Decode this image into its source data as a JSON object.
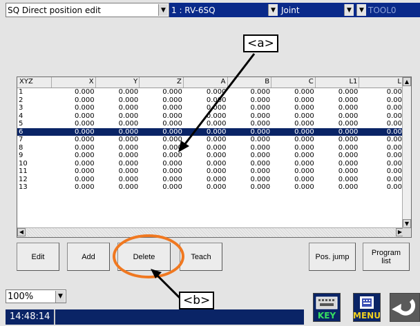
{
  "toolbar": {
    "program": "SQ Direct position edit",
    "robot": "1 : RV-6SQ",
    "mode": "Joint",
    "tool": "TOOL0"
  },
  "grid": {
    "headers": [
      "XYZ",
      "X",
      "Y",
      "Z",
      "A",
      "B",
      "C",
      "L1",
      "L"
    ],
    "rows": [
      {
        "id": "1",
        "v": [
          "0.000",
          "0.000",
          "0.000",
          "0.000",
          "0.000",
          "0.000",
          "0.000",
          "0.00"
        ]
      },
      {
        "id": "2",
        "v": [
          "0.000",
          "0.000",
          "0.000",
          "0.000",
          "0.000",
          "0.000",
          "0.000",
          "0.00"
        ]
      },
      {
        "id": "3",
        "v": [
          "0.000",
          "0.000",
          "0.000",
          "0.000",
          "0.000",
          "0.000",
          "0.000",
          "0.00"
        ]
      },
      {
        "id": "4",
        "v": [
          "0.000",
          "0.000",
          "0.000",
          "0.000",
          "0.000",
          "0.000",
          "0.000",
          "0.00"
        ]
      },
      {
        "id": "5",
        "v": [
          "0.000",
          "0.000",
          "0.000",
          "0.000",
          "0.000",
          "0.000",
          "0.000",
          "0.00"
        ]
      },
      {
        "id": "6",
        "v": [
          "0.000",
          "0.000",
          "0.000",
          "0.000",
          "0.000",
          "0.000",
          "0.000",
          "0.00"
        ],
        "selected": true
      },
      {
        "id": "7",
        "v": [
          "0.000",
          "0.000",
          "0.000",
          "0.000",
          "0.000",
          "0.000",
          "0.000",
          "0.00"
        ]
      },
      {
        "id": "8",
        "v": [
          "0.000",
          "0.000",
          "0.000",
          "0.000",
          "0.000",
          "0.000",
          "0.000",
          "0.00"
        ]
      },
      {
        "id": "9",
        "v": [
          "0.000",
          "0.000",
          "0.000",
          "0.000",
          "0.000",
          "0.000",
          "0.000",
          "0.00"
        ]
      },
      {
        "id": "10",
        "v": [
          "0.000",
          "0.000",
          "0.000",
          "0.000",
          "0.000",
          "0.000",
          "0.000",
          "0.00"
        ]
      },
      {
        "id": "11",
        "v": [
          "0.000",
          "0.000",
          "0.000",
          "0.000",
          "0.000",
          "0.000",
          "0.000",
          "0.00"
        ]
      },
      {
        "id": "12",
        "v": [
          "0.000",
          "0.000",
          "0.000",
          "0.000",
          "0.000",
          "0.000",
          "0.000",
          "0.00"
        ]
      },
      {
        "id": "13",
        "v": [
          "0.000",
          "0.000",
          "0.000",
          "0.000",
          "0.000",
          "0.000",
          "0.000",
          "0.00"
        ]
      }
    ]
  },
  "buttons": {
    "edit": "Edit",
    "add": "Add",
    "delete": "Delete",
    "teach": "Teach",
    "pos_jump": "Pos. jump",
    "program_list": "Program list"
  },
  "footer": {
    "zoom": "100%",
    "time": "14:48:14",
    "key_label": "KEY",
    "menu_label": "MENU"
  },
  "annotations": {
    "a": "<a>",
    "b": "<b>"
  },
  "colors": {
    "selection": "#0a2466",
    "highlight_circle": "#f07820"
  }
}
